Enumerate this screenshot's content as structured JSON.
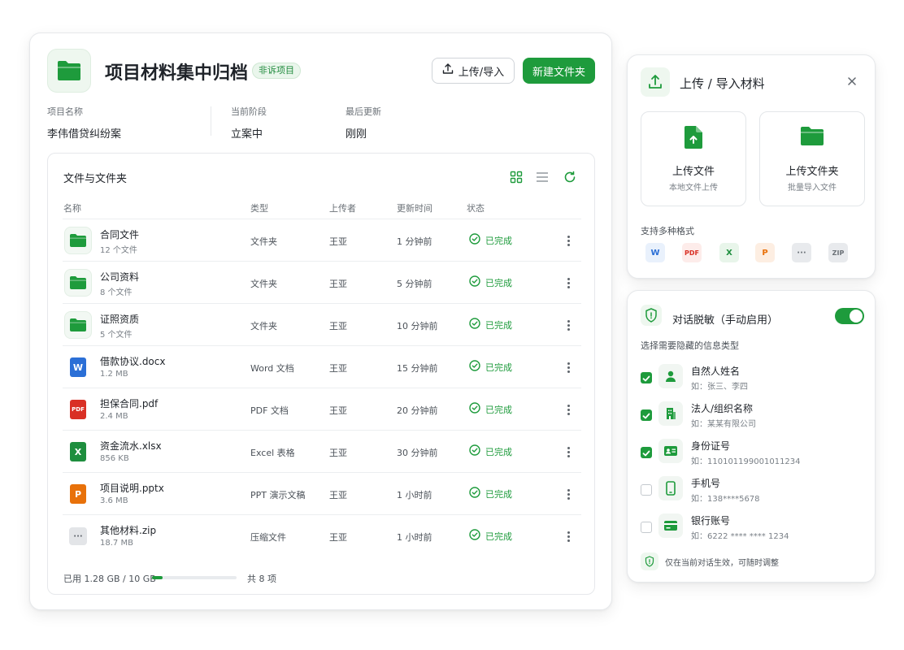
{
  "project": {
    "title": "项目材料集中归档",
    "badge": "非诉项目",
    "upload_button": "上传/导入",
    "new_folder_button": "新建文件夹",
    "meta": [
      {
        "label": "项目名称",
        "value": "李伟借贷纠纷案"
      },
      {
        "label": "当前阶段",
        "value": "立案中"
      },
      {
        "label": "最后更新",
        "value": "刚刚"
      }
    ]
  },
  "files": {
    "section_title": "文件与文件夹",
    "columns": [
      "名称",
      "类型",
      "上传者",
      "更新时间",
      "状态"
    ],
    "rows": [
      {
        "icon": "folder-icon",
        "name": "合同文件",
        "sub": "12 个文件",
        "type": "文件夹",
        "uploader": "王亚",
        "time": "1 分钟前",
        "status": "已完成"
      },
      {
        "icon": "folder-icon",
        "name": "公司资料",
        "sub": "8 个文件",
        "type": "文件夹",
        "uploader": "王亚",
        "time": "5 分钟前",
        "status": "已完成"
      },
      {
        "icon": "folder-icon",
        "name": "证照资质",
        "sub": "5 个文件",
        "type": "文件夹",
        "uploader": "王亚",
        "time": "10 分钟前",
        "status": "已完成"
      },
      {
        "icon": "word-file-icon",
        "name": "借款协议.docx",
        "sub": "1.2 MB",
        "type": "Word 文档",
        "uploader": "王亚",
        "time": "15 分钟前",
        "status": "已完成"
      },
      {
        "icon": "pdf-file-icon",
        "name": "担保合同.pdf",
        "sub": "2.4 MB",
        "type": "PDF 文档",
        "uploader": "王亚",
        "time": "20 分钟前",
        "status": "已完成"
      },
      {
        "icon": "excel-file-icon",
        "name": "资金流水.xlsx",
        "sub": "856 KB",
        "type": "Excel 表格",
        "uploader": "王亚",
        "time": "30 分钟前",
        "status": "已完成"
      },
      {
        "icon": "ppt-file-icon",
        "name": "项目说明.pptx",
        "sub": "3.6 MB",
        "type": "PPT 演示文稿",
        "uploader": "王亚",
        "time": "1 小时前",
        "status": "已完成"
      },
      {
        "icon": "zip-file-icon",
        "name": "其他材料.zip",
        "sub": "18.7 MB",
        "type": "压缩文件",
        "uploader": "王亚",
        "time": "1 小时前",
        "status": "已完成"
      }
    ],
    "storage_label": "已用 1.28 GB / 10 GB",
    "storage_fraction": 0.128,
    "total_label": "共 8 项"
  },
  "upload_panel": {
    "title": "上传 / 导入材料",
    "tiles": [
      {
        "label": "上传文件",
        "sub": "本地文件上传"
      },
      {
        "label": "上传文件夹",
        "sub": "批量导入文件"
      }
    ],
    "formats_label": "支持多种格式",
    "formats": [
      {
        "text": "W",
        "color": "#2b6fd6",
        "bg": "#e9f1fc"
      },
      {
        "text": "PDF",
        "color": "#d93025",
        "bg": "#fdecea"
      },
      {
        "text": "X",
        "color": "#1e8e3e",
        "bg": "#e8f5ea"
      },
      {
        "text": "P",
        "color": "#e8710a",
        "bg": "#fdeee2"
      },
      {
        "text": "···",
        "color": "#6b7177",
        "bg": "#e8eaed"
      },
      {
        "text": "ZIP",
        "color": "#6b7177",
        "bg": "#e8eaed"
      }
    ]
  },
  "redaction": {
    "title": "对话脱敏（手动启用）",
    "enabled": true,
    "subtitle": "选择需要隐藏的信息类型",
    "options": [
      {
        "icon": "person-icon",
        "label": "自然人姓名",
        "example": "如：张三、李四",
        "checked": true
      },
      {
        "icon": "building-icon",
        "label": "法人/组织名称",
        "example": "如：某某有限公司",
        "checked": true
      },
      {
        "icon": "id-card-icon",
        "label": "身份证号",
        "example": "如：110101199001011234",
        "checked": true
      },
      {
        "icon": "phone-icon",
        "label": "手机号",
        "example": "如：138****5678",
        "checked": false
      },
      {
        "icon": "bank-card-icon",
        "label": "银行账号",
        "example": "如：6222 **** **** 1234",
        "checked": false
      }
    ],
    "note": "仅在当前对话生效，可随时调整"
  },
  "colors": {
    "accent": "#1e9b3c",
    "accent_light": "#eef7ef"
  }
}
